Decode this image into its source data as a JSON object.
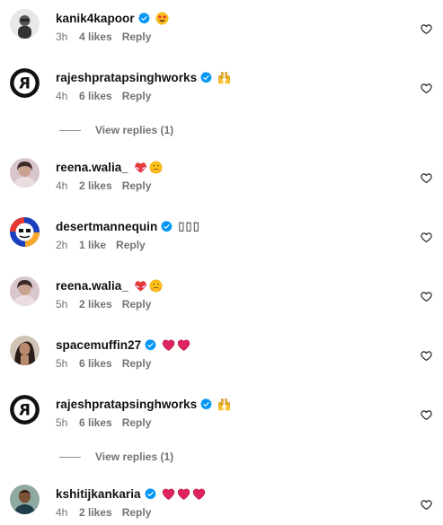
{
  "comments": [
    {
      "username": "kanik4kapoor",
      "verified": true,
      "time": "3h",
      "likes": "4 likes",
      "reply": "Reply",
      "emojis": [
        "star-struck-emoji"
      ],
      "avatar": "avatar-kanik"
    },
    {
      "username": "rajeshpratapsinghworks",
      "verified": true,
      "time": "4h",
      "likes": "6 likes",
      "reply": "Reply",
      "emojis": [
        "raised-hands-emoji"
      ],
      "avatar": "avatar-r-logo",
      "view_replies": "View replies (1)"
    },
    {
      "username": "reena.walia_",
      "verified": false,
      "time": "4h",
      "likes": "2 likes",
      "reply": "Reply",
      "emojis": [
        "heart-with-ribbon-emoji",
        "hugging-face-emoji"
      ],
      "avatar": "avatar-reena"
    },
    {
      "username": "desertmannequin",
      "verified": true,
      "time": "2h",
      "likes": "1 like",
      "reply": "Reply",
      "text": "▯▯▯",
      "avatar": "avatar-desert"
    },
    {
      "username": "reena.walia_",
      "verified": false,
      "time": "5h",
      "likes": "2 likes",
      "reply": "Reply",
      "emojis": [
        "heart-with-ribbon-emoji",
        "hugging-face-emoji"
      ],
      "avatar": "avatar-reena"
    },
    {
      "username": "spacemuffin27",
      "verified": true,
      "time": "5h",
      "likes": "6 likes",
      "reply": "Reply",
      "emojis": [
        "red-heart-emoji",
        "red-heart-emoji"
      ],
      "avatar": "avatar-spacemuffin"
    },
    {
      "username": "rajeshpratapsinghworks",
      "verified": true,
      "time": "5h",
      "likes": "6 likes",
      "reply": "Reply",
      "emojis": [
        "raised-hands-emoji"
      ],
      "avatar": "avatar-r-logo",
      "view_replies": "View replies (1)"
    },
    {
      "username": "kshitijkankaria",
      "verified": true,
      "time": "4h",
      "likes": "2 likes",
      "reply": "Reply",
      "emojis": [
        "red-heart-emoji",
        "red-heart-emoji",
        "red-heart-emoji"
      ],
      "avatar": "avatar-kshitij"
    }
  ],
  "colors": {
    "verified_blue": "#0095f6",
    "meta_gray": "#737373",
    "heart_red": "#e0245e"
  }
}
